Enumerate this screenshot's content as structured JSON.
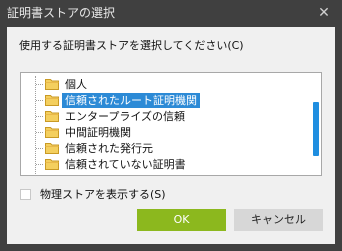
{
  "window": {
    "title": "証明書ストアの選択",
    "close_glyph": "✕"
  },
  "prompt": "使用する証明書ストアを選択してください(C)",
  "tree": {
    "items": [
      {
        "label": "個人",
        "icon": "folder-icon",
        "selected": false
      },
      {
        "label": "信頼されたルート証明機関",
        "icon": "folder-icon",
        "selected": true
      },
      {
        "label": "エンタープライズの信頼",
        "icon": "folder-icon",
        "selected": false
      },
      {
        "label": "中間証明機関",
        "icon": "folder-icon",
        "selected": false
      },
      {
        "label": "信頼された発行元",
        "icon": "folder-icon",
        "selected": false
      },
      {
        "label": "信頼されていない証明書",
        "icon": "folder-icon",
        "selected": false
      }
    ]
  },
  "checkbox": {
    "label": "物理ストアを表示する(S)",
    "checked": false
  },
  "buttons": {
    "ok": "OK",
    "cancel": "キャンセル"
  },
  "colors": {
    "titlebar": "#404040",
    "selection": "#2c8ad6",
    "ok_button": "#8cb81e",
    "cancel_button": "#d7d7d7",
    "scroll_thumb": "#1f8ee0"
  }
}
